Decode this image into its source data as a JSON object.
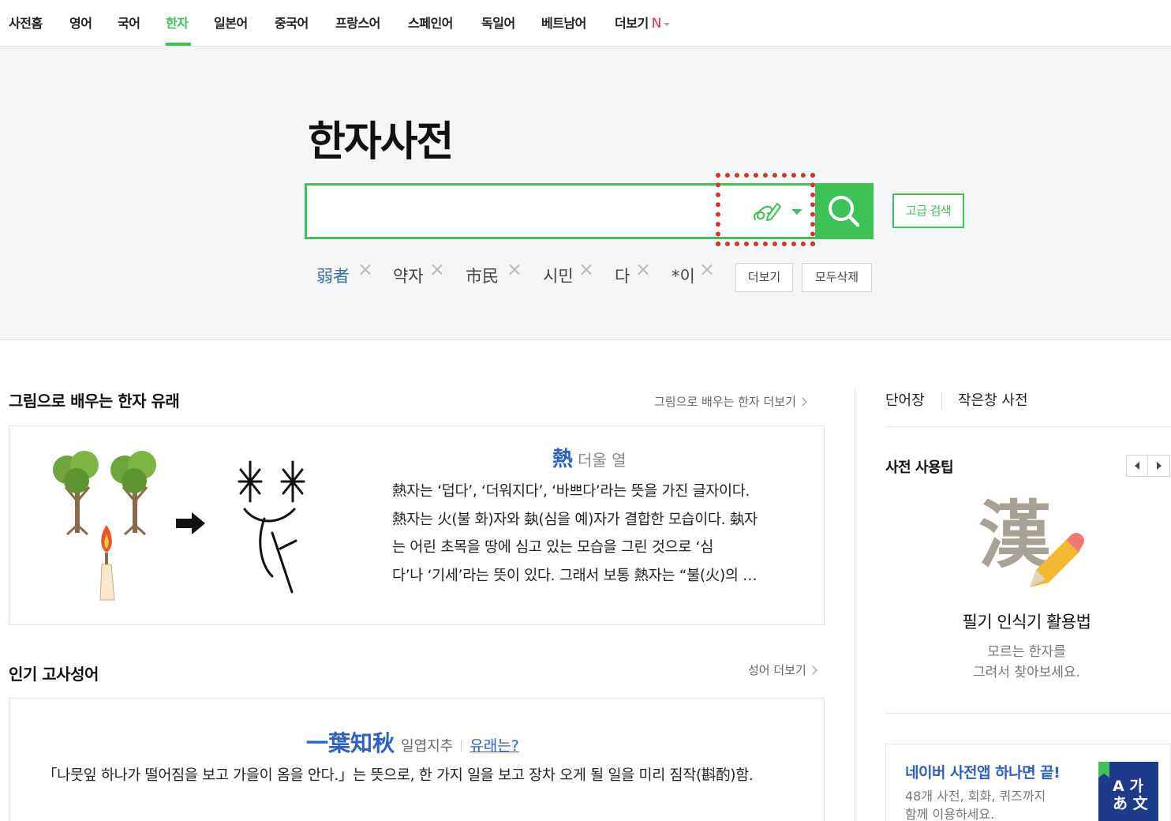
{
  "nav": {
    "items": [
      "사전홈",
      "영어",
      "국어",
      "한자",
      "일본어",
      "중국어",
      "프랑스어",
      "스페인어",
      "독일어",
      "베트남어",
      "더보기"
    ],
    "active": "한자",
    "new_mark": "N"
  },
  "search": {
    "title": "한자사전",
    "query": "",
    "advanced_label": "고급 검색",
    "recent": [
      "弱者",
      "약자",
      "市民",
      "시민",
      "다",
      "*이"
    ],
    "more_label": "더보기",
    "delete_all_label": "모두삭제"
  },
  "origin": {
    "section_title": "그림으로 배우는 한자 유래",
    "more_label": "그림으로 배우는 한자 더보기",
    "char": "熱",
    "reading": "더울 열",
    "lines": [
      "熱자는 ‘덥다’, ‘더워지다’, ‘바쁘다’라는 뜻을 가진 글자이다.",
      "熱자는 火(불 화)자와 埶(심을 예)자가 결합한 모습이다. 埶자",
      "는 어린 초목을 땅에 심고 있는 모습을 그린 것으로 ‘심",
      "다’나 ‘기세’라는 뜻이 있다. 그래서 보통 熱자는 “불(火)의 …"
    ]
  },
  "idiom": {
    "section_title": "인기 고사성어",
    "more_label": "성어 더보기",
    "hanja": "一葉知秋",
    "reading": "일엽지추",
    "origin_link": "유래는?",
    "meaning": "「나뭇잎 하나가 떨어짐을 보고 가을이 옴을 안다.」는 뜻으로, 한 가지 일을 보고 장차 오게 될 일을 미리 짐작(斟酌)함."
  },
  "sidebar": {
    "tabs": [
      "단어장",
      "작은창 사전"
    ],
    "tips_title": "사전 사용팁",
    "tip_glyph": "漢",
    "tip_heading": "필기 인식기 활용법",
    "tip_desc": [
      "모르는 한자를",
      "그려서 찾아보세요."
    ],
    "app_title": "네이버 사전앱 하나면 끝!",
    "app_desc": [
      "48개 사전, 회화, 퀴즈까지",
      "함께 이용하세요."
    ],
    "app_icon_text": [
      "A 가",
      "あ 文"
    ]
  },
  "colors": {
    "accent_green": "#3ec255",
    "link_blue": "#2b60c9",
    "highlight_red": "#d9342b",
    "new_red": "#e9284f"
  }
}
